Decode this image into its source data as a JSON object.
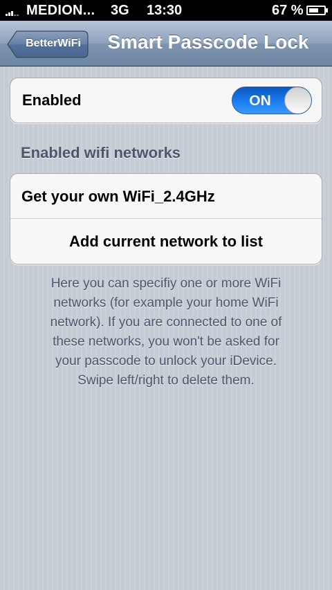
{
  "status_bar": {
    "carrier": "MEDION...",
    "network": "3G",
    "time": "13:30",
    "battery_percent": "67 %",
    "battery_level": 0.67
  },
  "nav": {
    "back_label": "BetterWiFi",
    "title": "Smart Passcode Lock"
  },
  "enabled_cell": {
    "label": "Enabled",
    "toggle_text": "ON",
    "toggle_state": true,
    "toggle_color": "#1b7ff1"
  },
  "networks_section": {
    "header": "Enabled wifi networks",
    "networks": [
      "Get your own WiFi_2.4GHz"
    ],
    "add_button": "Add current network to list"
  },
  "footer": {
    "line1": "Here you can specifiy one or more WiFi",
    "line2": "networks (for example your home WiFi",
    "line3": "network). If you are connected to one of",
    "line4": "these networks, you won't be asked for",
    "line5": "your passcode to unlock your iDevice.",
    "line6": "Swipe left/right to delete them."
  },
  "icons": {
    "signal": "signal-bars-icon",
    "battery": "battery-icon",
    "back": "back-arrow-button"
  }
}
